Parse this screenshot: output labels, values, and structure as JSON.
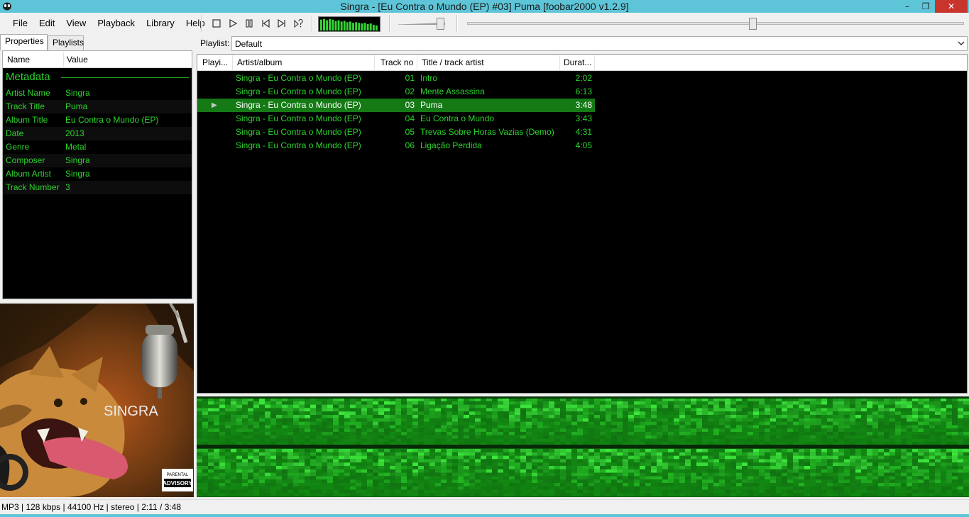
{
  "window": {
    "title": "Singra - [Eu Contra o Mundo (EP) #03] Puma   [foobar2000 v1.2.9]",
    "minimize_symbol": "–",
    "maximize_symbol": "❐",
    "close_symbol": "✕"
  },
  "menu": [
    "File",
    "Edit",
    "View",
    "Playback",
    "Library",
    "Help"
  ],
  "toolbar_icons": [
    "stop-icon",
    "play-icon",
    "pause-icon",
    "previous-icon",
    "next-icon",
    "random-icon"
  ],
  "left_tabs": {
    "properties": "Properties",
    "playlists": "Playlists"
  },
  "properties": {
    "col_name": "Name",
    "col_value": "Value",
    "section": "Metadata",
    "rows": [
      {
        "name": "Artist Name",
        "value": "Singra"
      },
      {
        "name": "Track Title",
        "value": "Puma"
      },
      {
        "name": "Album Title",
        "value": "Eu Contra o Mundo (EP)"
      },
      {
        "name": "Date",
        "value": "2013"
      },
      {
        "name": "Genre",
        "value": "Metal"
      },
      {
        "name": "Composer",
        "value": "Singra"
      },
      {
        "name": "Album Artist",
        "value": "Singra"
      },
      {
        "name": "Track Number",
        "value": "3"
      }
    ]
  },
  "album_art": {
    "band": "SINGRA",
    "parental_line1": "PARENTAL",
    "parental_line2": "ADVISORY"
  },
  "playlist_selector": {
    "label": "Playlist:",
    "value": "Default"
  },
  "playlist": {
    "columns": {
      "playing": "Playi...",
      "artist_album": "Artist/album",
      "track_no": "Track no",
      "title": "Title / track artist",
      "duration": "Durat..."
    },
    "playing_indicator": "▶",
    "rows": [
      {
        "artist_album": "Singra - Eu Contra o Mundo (EP)",
        "no": "01",
        "title": "Intro",
        "duration": "2:02"
      },
      {
        "artist_album": "Singra - Eu Contra o Mundo (EP)",
        "no": "02",
        "title": "Mente Assassina",
        "duration": "6:13"
      },
      {
        "artist_album": "Singra - Eu Contra o Mundo (EP)",
        "no": "03",
        "title": "Puma",
        "duration": "3:48"
      },
      {
        "artist_album": "Singra - Eu Contra o Mundo (EP)",
        "no": "04",
        "title": "Eu Contra o Mundo",
        "duration": "3:43"
      },
      {
        "artist_album": "Singra - Eu Contra o Mundo (EP)",
        "no": "05",
        "title": "Trevas Sobre Horas Vazias (Demo)",
        "duration": "4:31"
      },
      {
        "artist_album": "Singra - Eu Contra o Mundo (EP)",
        "no": "06",
        "title": "Ligação Perdida",
        "duration": "4:05"
      }
    ]
  },
  "playback": {
    "position_fraction": 0.574,
    "volume_fraction": 0.9
  },
  "status": "MP3 | 128 kbps | 44100 Hz | stereo | 2:11 / 3:48",
  "colors": {
    "text_green": "#2bd42b",
    "selected_row": "#157a15",
    "titlebar": "#5ec5d8",
    "close": "#c7352d"
  }
}
